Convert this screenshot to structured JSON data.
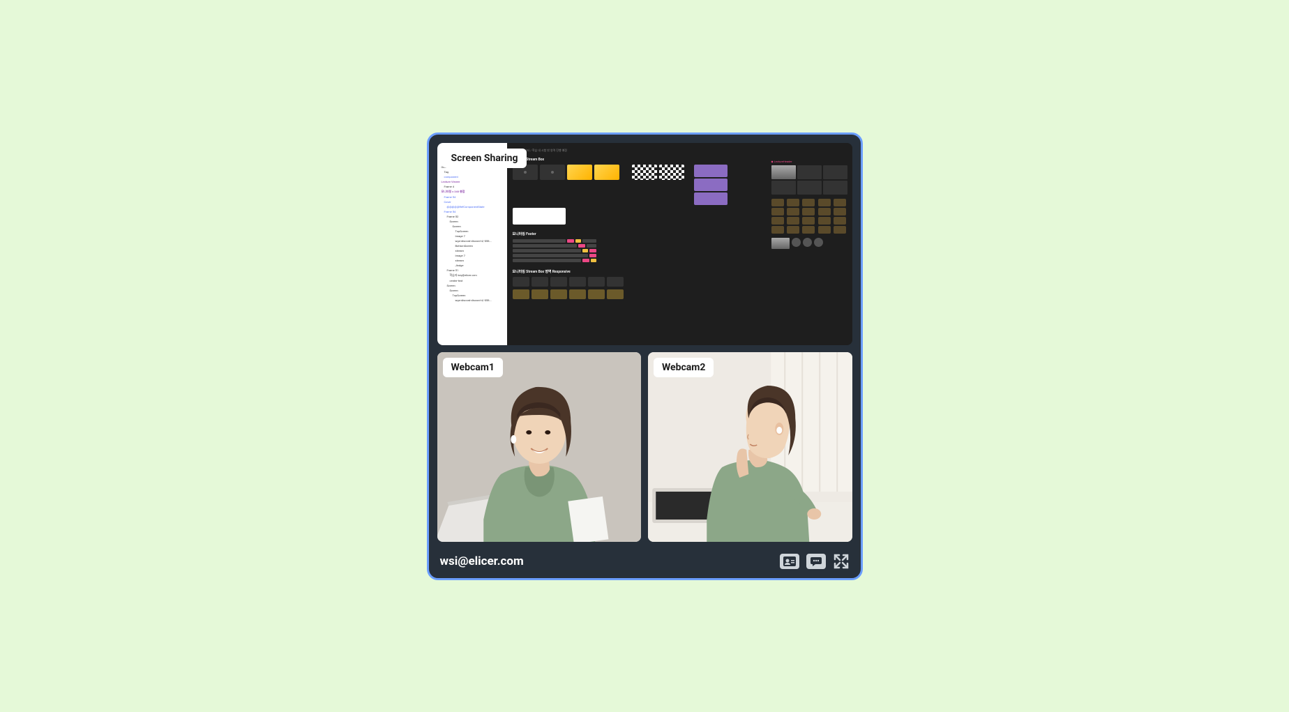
{
  "panels": {
    "screen_share": {
      "label": "Screen Sharing"
    },
    "webcam1": {
      "label": "Webcam1"
    },
    "webcam2": {
      "label": "Webcam2"
    }
  },
  "footer": {
    "email": "wsi@elicer.com",
    "buttons": {
      "contact": "contact-card-icon",
      "chat": "chat-icon",
      "expand": "expand-icon"
    }
  },
  "screen_content": {
    "tree": [
      {
        "text": "Outlined",
        "cls": ""
      },
      {
        "text": "Tag",
        "cls": "i1"
      },
      {
        "text": "component",
        "cls": "i1 blue"
      },
      {
        "text": "Lecture Viewer",
        "cls": "purple"
      },
      {
        "text": "Frame 4",
        "cls": "i1"
      },
      {
        "text": "모니터링 x 348 총합",
        "cls": "purple"
      },
      {
        "text": "Frame 54",
        "cls": "i1 blue"
      },
      {
        "text": "Cover",
        "cls": "i1 blue"
      },
      {
        "text": "@@@@@RefComponentState",
        "cls": "i2 blue"
      },
      {
        "text": "Frame 54",
        "cls": "i1 blue"
      },
      {
        "text": "Frame 52",
        "cls": "i2"
      },
      {
        "text": "Screen",
        "cls": "i3"
      },
      {
        "text": "Screen",
        "cls": "i4"
      },
      {
        "text": "TopScreen",
        "cls": "i5"
      },
      {
        "text": "Image 7",
        "cls": "i5"
      },
      {
        "text": "wgn-discord-discord-4/-058...",
        "cls": "i5"
      },
      {
        "text": "BottomScreen",
        "cls": "i5"
      },
      {
        "text": "stream",
        "cls": "i5"
      },
      {
        "text": "Image 7",
        "cls": "i5"
      },
      {
        "text": "stream",
        "cls": "i5"
      },
      {
        "text": "Jindge",
        "cls": "i5"
      },
      {
        "text": "Frame 51",
        "cls": "i2"
      },
      {
        "text": "학습자 key@elicer.orm",
        "cls": "i3"
      },
      {
        "text": "center-text",
        "cls": "i3"
      },
      {
        "text": "Screen",
        "cls": "i2"
      },
      {
        "text": "Screen",
        "cls": "i3"
      },
      {
        "text": "TopScreen",
        "cls": "i4"
      },
      {
        "text": "wgn-discord-discord-4/-058...",
        "cls": "i5"
      }
    ],
    "sections": [
      {
        "title": "모니터링 Stream Box"
      },
      {
        "title": "모니터링 Footer"
      },
      {
        "title": "모니터링 Stream Box 영역 Responsive"
      }
    ],
    "header_crumb": "Legacy 모니터 / 학습 내 시험 밖 영역 진행 예정"
  }
}
